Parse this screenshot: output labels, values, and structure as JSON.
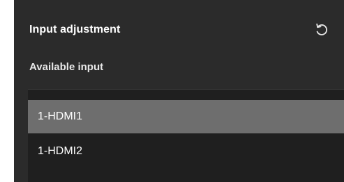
{
  "panel": {
    "title": "Input adjustment",
    "reset_icon": "reset-icon",
    "section_label": "Available input",
    "inputs": [
      {
        "label": "1-HDMI1",
        "selected": true
      },
      {
        "label": "1-HDMI2",
        "selected": false
      }
    ]
  },
  "colors": {
    "panel_bg": "#2b2b2b",
    "list_bg": "#1f1f1f",
    "selected_bg": "#6e6e6e",
    "text": "#ffffff"
  }
}
